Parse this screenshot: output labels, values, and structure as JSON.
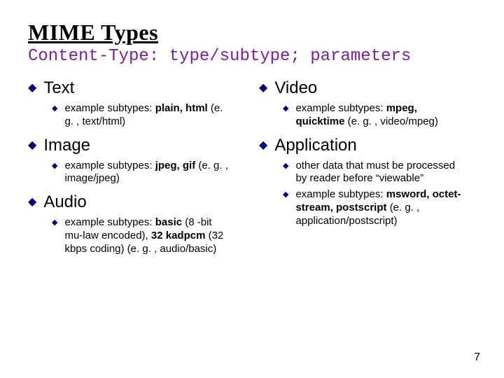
{
  "title": "MIME Types",
  "subtitle": "Content-Type: type/subtype; parameters",
  "left": [
    {
      "label": "Text",
      "items": [
        {
          "pre": "example subtypes: ",
          "bold": "plain, html",
          "post": " (e. g. , text/html)"
        }
      ]
    },
    {
      "label": "Image",
      "items": [
        {
          "pre": "example subtypes: ",
          "bold": "jpeg, gif",
          "post": " (e. g. , image/jpeg)"
        }
      ]
    },
    {
      "label": "Audio",
      "items": [
        {
          "pre": "example subtypes: ",
          "bold": "basic ",
          "post": "(8 -bit mu-law encoded), ",
          "bold2": "32 kadpcm ",
          "post2": "(32 kbps coding) (e. g. , audio/basic)"
        }
      ]
    }
  ],
  "right": [
    {
      "label": "Video",
      "items": [
        {
          "pre": "example subtypes: ",
          "bold": "mpeg, quicktime ",
          "post": "(e. g. , video/mpeg)"
        }
      ]
    },
    {
      "label": "Application",
      "items": [
        {
          "pre": "other data that must be processed by reader before “viewable”",
          "bold": "",
          "post": ""
        },
        {
          "pre": "example subtypes: ",
          "bold": "msword, octet-stream, postscript ",
          "post": "(e. g. , application/postscript)"
        }
      ]
    }
  ],
  "pagenum": "7",
  "glyphs": {
    "l1": "◆",
    "l2": "◆"
  }
}
